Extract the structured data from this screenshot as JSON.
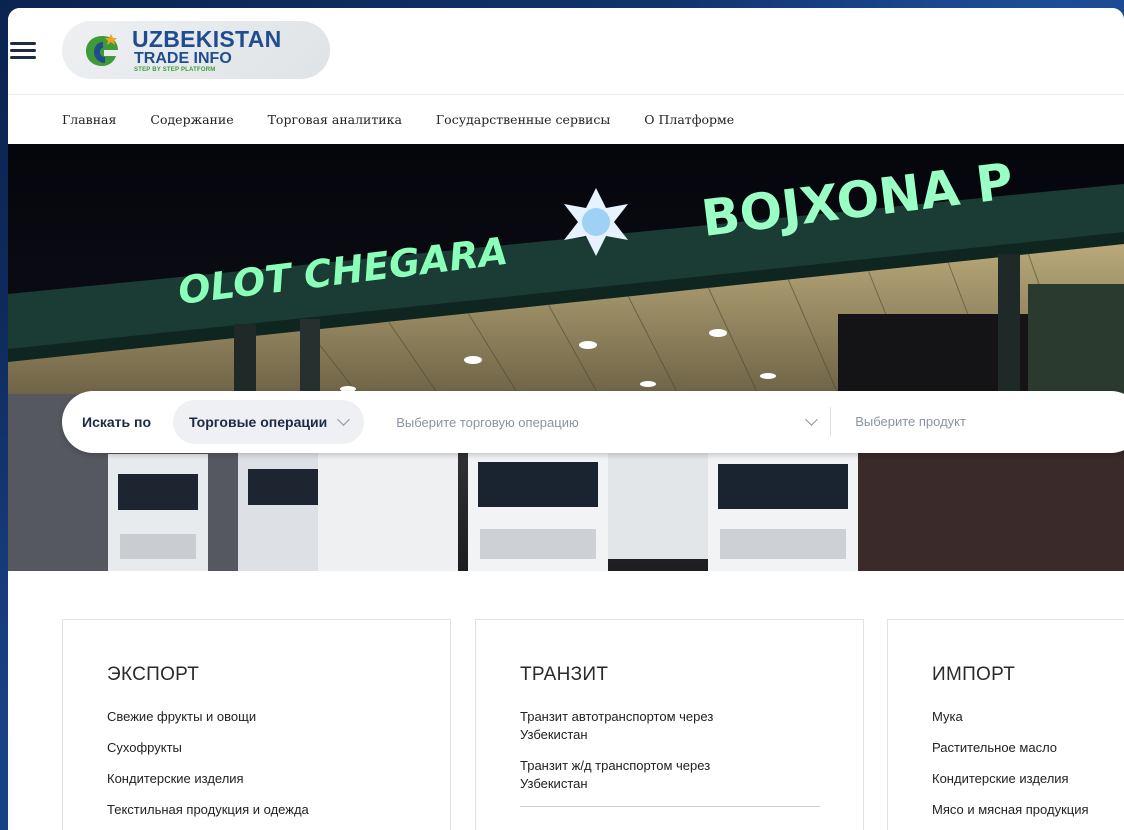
{
  "logo": {
    "line1": "UZBEKISTAN",
    "line2": "TRADE INFO",
    "line3": "STEP BY STEP PLATFORM"
  },
  "nav": [
    "Главная",
    "Содержание",
    "Торговая аналитика",
    "Государственные сервисы",
    "О Платформе"
  ],
  "hero": {
    "sign_left": "OLOT CHEGARA",
    "sign_right": "BOJXONA P"
  },
  "search": {
    "label": "Искать по",
    "operation": "Торговые операции",
    "trade_placeholder": "Выберите торговую операцию",
    "product_placeholder": "Выберите продукт"
  },
  "cards": [
    {
      "title": "ЭКСПОРТ",
      "items": [
        "Свежие фрукты и овощи",
        "Сухофрукты",
        "Кондитерские изделия",
        "Текстильная продукция и одежда"
      ]
    },
    {
      "title": "ТРАНЗИТ",
      "items": [
        "Транзит автотранспортом через Узбекистан",
        "Транзит ж/д транспортом через Узбекистан"
      ]
    },
    {
      "title": "ИМПОРТ",
      "items": [
        "Мука",
        "Растительное масло",
        "Кондитерские изделия",
        "Мясо и мясная продукция"
      ]
    }
  ],
  "colors": {
    "brand_blue": "#1f4d8f",
    "brand_green": "#3f9a3a",
    "sign_green": "#7fffb0"
  }
}
